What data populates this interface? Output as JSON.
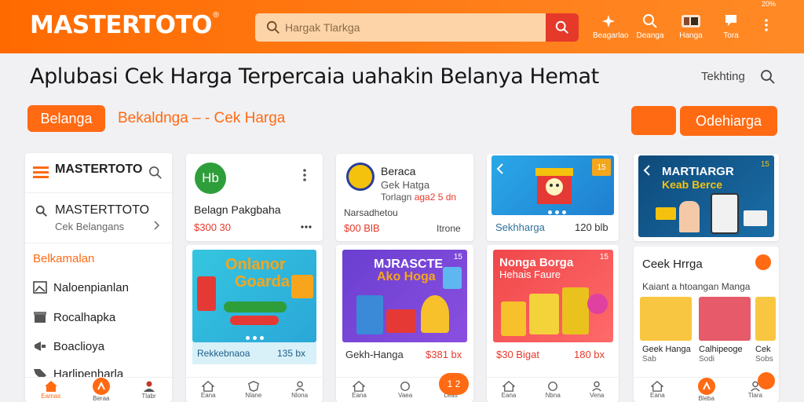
{
  "header": {
    "logo": "MASTERTOTO",
    "search_placeholder": "Hargak Tlarkga",
    "nav": [
      {
        "icon": "plane-icon",
        "label": "Beagarlao"
      },
      {
        "icon": "search-icon",
        "label": "Deanga"
      },
      {
        "icon": "basket-icon",
        "label": "Hanga"
      },
      {
        "icon": "flag-icon",
        "label": "Tora"
      }
    ],
    "status": "20%"
  },
  "headline": "Aplubasi Cek Harga Terpercaia uahakin Belanya Hemat",
  "top_link": "Tekhting",
  "row2": {
    "left_button": "Belanga",
    "subtitle": "Bekaldnga – - Cek Harga",
    "right_button": "Odehiarga"
  },
  "sidebar": {
    "title": "MASTERTOTO",
    "account_name": "MASTERTTOTO",
    "account_sub": "Cek Belangans",
    "section": "Belkamalan",
    "items": [
      "Naloenpianlan",
      "Rocalhapka",
      "Boaclioya",
      "Harlipenharla"
    ],
    "bottom": [
      "Eamas",
      "Beraa",
      "Tlabr"
    ]
  },
  "card2": {
    "logo_text": "Hb",
    "title": "Belagn Pakgbaha",
    "price": "$300 30"
  },
  "card3": {
    "title": "Beraca",
    "sub1": "Gek Hatga",
    "sub2": "Torlagn",
    "sub2_price": "aga2 5 dn",
    "line": "Narsadhetou",
    "price": "$00 BlB",
    "right": "Itrone"
  },
  "card4": {
    "badge": "15",
    "label": "Sekhharga",
    "price": "120 blb"
  },
  "card5": {
    "title": "MARTIARGR",
    "subtitle": "Keab Berce",
    "badge": "15"
  },
  "promo1": {
    "title1": "Onlanor",
    "title2": "Goarda",
    "footer": "Rekkebnaoa",
    "price": "135 bx",
    "bottom": [
      "Eana",
      "Nlane",
      "Nlona"
    ]
  },
  "promo2": {
    "title1": "MJRASCTE",
    "title2": "Ako Hoga",
    "badge": "15",
    "footer": "Gekh-Hanga",
    "price": "$381 bx",
    "bottom": [
      "Eana",
      "Vaea",
      "Leas"
    ],
    "fab": "1 2"
  },
  "promo3": {
    "title1": "Nonga Borga",
    "title2": "Hehais Faure",
    "badge": "15",
    "footer": "$30 Bigat",
    "price": "180 bx",
    "bottom": [
      "Eana",
      "Nbna",
      "Vena"
    ]
  },
  "card6": {
    "title": "Ceek Hrrga",
    "subtitle": "Kaiant a htoangan Manga",
    "products": [
      {
        "name": "Geek Hanga",
        "sub": "Sab"
      },
      {
        "name": "Calhipeoge",
        "sub": "Sodi"
      },
      {
        "name": "Cek",
        "sub": "Sobs"
      }
    ],
    "bottom": [
      "Eana",
      "Bleba",
      "Tlara"
    ]
  },
  "colors": {
    "accent": "#ff6a13",
    "red": "#e5392a"
  }
}
